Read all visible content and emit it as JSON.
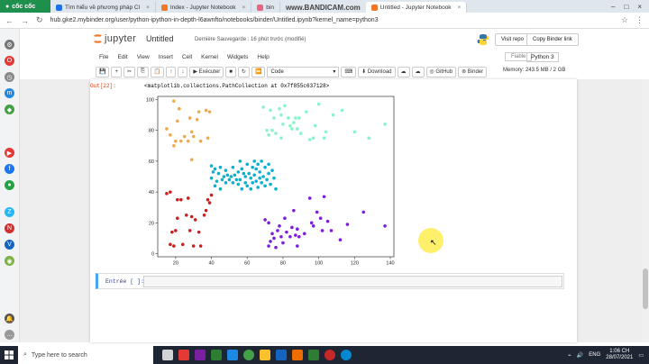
{
  "browser": {
    "brand": "cốc cốc",
    "tabs": [
      {
        "label": "Tìm hiểu về phương pháp Cl",
        "active": false
      },
      {
        "label": "Index - Jupyter Notebook",
        "active": false
      },
      {
        "label": "bin",
        "active": false
      },
      {
        "label": "Untitled - Jupyter Notebook",
        "active": true
      }
    ],
    "watermark": "www.BANDICAM.com",
    "url": "hub.gke2.mybinder.org/user/python-ipython-in-depth-l6awnfto/notebooks/binder/Untitled.ipynb?kernel_name=python3"
  },
  "jupyter": {
    "logo_text": "jupyter",
    "notebook_name": "Untitled",
    "save_status": "Dernière Sauvegarde : 16 phút trước  (modifié)",
    "visit_repo": "Visit repo",
    "copy_binder": "Copy Binder link",
    "menu": [
      "File",
      "Edit",
      "View",
      "Insert",
      "Cell",
      "Kernel",
      "Widgets",
      "Help"
    ],
    "trusted": "Fiable",
    "kernel": "Python 3",
    "toolbar": {
      "run": "Exécuter",
      "cell_type": "Code",
      "download": "Download",
      "github": "GitHub",
      "binder": "Binder"
    },
    "memory": "Memory: 243.5 MB / 2 GB"
  },
  "cell_output": {
    "prompt": "Out[22]:",
    "text": "<matplotlib.collections.PathCollection at 0x7f855c637128>"
  },
  "input_cell": {
    "prompt": "Entrée [ ]:"
  },
  "chart_data": {
    "type": "scatter",
    "xlim": [
      10,
      142
    ],
    "ylim": [
      -2,
      102
    ],
    "xticks": [
      20,
      40,
      60,
      80,
      100,
      120,
      140
    ],
    "yticks": [
      0,
      20,
      40,
      60,
      80,
      100
    ],
    "series": [
      {
        "color": "#f5a742",
        "points": [
          [
            15,
            81
          ],
          [
            17,
            77
          ],
          [
            19,
            99
          ],
          [
            19,
            70
          ],
          [
            20,
            73
          ],
          [
            21,
            86
          ],
          [
            22,
            94
          ],
          [
            23,
            73
          ],
          [
            25,
            76
          ],
          [
            27,
            73
          ],
          [
            28,
            88
          ],
          [
            29,
            61
          ],
          [
            29,
            79
          ],
          [
            30,
            76
          ],
          [
            32,
            87
          ],
          [
            33,
            92
          ],
          [
            34,
            73
          ],
          [
            37,
            93
          ],
          [
            38,
            75
          ],
          [
            39,
            92
          ]
        ]
      },
      {
        "color": "#8df2c9",
        "points": [
          [
            69,
            95
          ],
          [
            71,
            80
          ],
          [
            72,
            77
          ],
          [
            73,
            93
          ],
          [
            74,
            80
          ],
          [
            75,
            88
          ],
          [
            76,
            78
          ],
          [
            78,
            94
          ],
          [
            79,
            75
          ],
          [
            79,
            90
          ],
          [
            80,
            84
          ],
          [
            81,
            96
          ],
          [
            83,
            88
          ],
          [
            84,
            83
          ],
          [
            85,
            81
          ],
          [
            86,
            85
          ],
          [
            87,
            88
          ],
          [
            88,
            81
          ],
          [
            89,
            88
          ],
          [
            90,
            78
          ],
          [
            93,
            92
          ],
          [
            95,
            74
          ],
          [
            97,
            75
          ],
          [
            98,
            83
          ],
          [
            100,
            97
          ],
          [
            103,
            75
          ],
          [
            104,
            79
          ],
          [
            108,
            90
          ],
          [
            113,
            93
          ],
          [
            120,
            79
          ],
          [
            128,
            75
          ],
          [
            137,
            84
          ]
        ]
      },
      {
        "color": "#00b4d4",
        "points": [
          [
            40,
            57
          ],
          [
            40,
            49
          ],
          [
            41,
            53
          ],
          [
            42,
            55
          ],
          [
            42,
            44
          ],
          [
            43,
            47
          ],
          [
            44,
            52
          ],
          [
            45,
            42
          ],
          [
            45,
            56
          ],
          [
            46,
            48
          ],
          [
            47,
            50
          ],
          [
            48,
            46
          ],
          [
            48,
            54
          ],
          [
            49,
            51
          ],
          [
            50,
            48
          ],
          [
            51,
            50
          ],
          [
            52,
            46
          ],
          [
            52,
            56
          ],
          [
            53,
            51
          ],
          [
            54,
            48
          ],
          [
            55,
            53
          ],
          [
            55,
            45
          ],
          [
            56,
            60
          ],
          [
            56,
            48
          ],
          [
            57,
            42
          ],
          [
            57,
            55
          ],
          [
            58,
            52
          ],
          [
            59,
            46
          ],
          [
            59,
            50
          ],
          [
            60,
            58
          ],
          [
            60,
            44
          ],
          [
            61,
            52
          ],
          [
            62,
            49
          ],
          [
            62,
            42
          ],
          [
            63,
            56
          ],
          [
            63,
            46
          ],
          [
            64,
            60
          ],
          [
            64,
            51
          ],
          [
            65,
            47
          ],
          [
            65,
            55
          ],
          [
            66,
            43
          ],
          [
            66,
            58
          ],
          [
            67,
            49
          ],
          [
            67,
            53
          ],
          [
            68,
            46
          ],
          [
            68,
            60
          ],
          [
            69,
            50
          ],
          [
            70,
            44
          ],
          [
            70,
            56
          ],
          [
            71,
            48
          ],
          [
            72,
            52
          ],
          [
            72,
            58
          ],
          [
            73,
            45
          ],
          [
            74,
            54
          ],
          [
            75,
            49
          ],
          [
            76,
            42
          ]
        ]
      },
      {
        "color": "#d41a1a",
        "points": [
          [
            15,
            39
          ],
          [
            17,
            40
          ],
          [
            17,
            6
          ],
          [
            18,
            14
          ],
          [
            19,
            5
          ],
          [
            20,
            15
          ],
          [
            21,
            35
          ],
          [
            21,
            23
          ],
          [
            23,
            35
          ],
          [
            24,
            6
          ],
          [
            26,
            25
          ],
          [
            27,
            36
          ],
          [
            28,
            15
          ],
          [
            29,
            24
          ],
          [
            30,
            5
          ],
          [
            31,
            22
          ],
          [
            33,
            14
          ],
          [
            34,
            5
          ],
          [
            36,
            25
          ],
          [
            37,
            28
          ],
          [
            38,
            35
          ],
          [
            39,
            33
          ],
          [
            40,
            38
          ]
        ]
      },
      {
        "color": "#7b1fd6",
        "points": [
          [
            70,
            22
          ],
          [
            72,
            20
          ],
          [
            72,
            5
          ],
          [
            73,
            8
          ],
          [
            74,
            13
          ],
          [
            75,
            10
          ],
          [
            76,
            4
          ],
          [
            77,
            15
          ],
          [
            78,
            18
          ],
          [
            79,
            11
          ],
          [
            80,
            7
          ],
          [
            81,
            23
          ],
          [
            82,
            14
          ],
          [
            84,
            11
          ],
          [
            85,
            17
          ],
          [
            86,
            28
          ],
          [
            87,
            12
          ],
          [
            88,
            16
          ],
          [
            88,
            5
          ],
          [
            89,
            11
          ],
          [
            92,
            13
          ],
          [
            95,
            36
          ],
          [
            96,
            20
          ],
          [
            97,
            18
          ],
          [
            99,
            27
          ],
          [
            101,
            23
          ],
          [
            102,
            15
          ],
          [
            103,
            37
          ],
          [
            105,
            21
          ],
          [
            107,
            15
          ],
          [
            112,
            9
          ],
          [
            116,
            19
          ],
          [
            125,
            27
          ],
          [
            137,
            18
          ]
        ]
      }
    ]
  }
}
